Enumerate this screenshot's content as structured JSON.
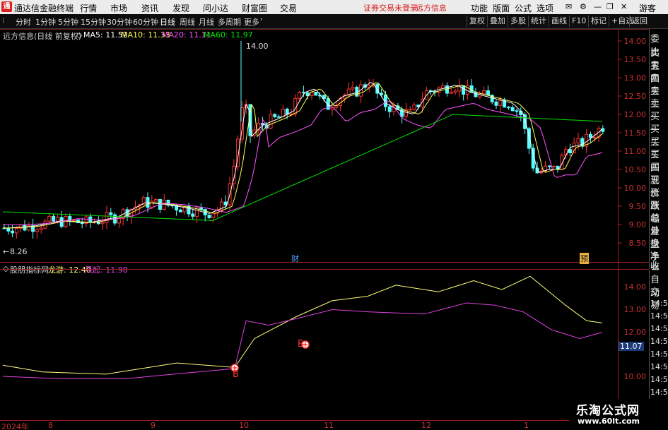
{
  "menubar": {
    "title": "通达信金融终端",
    "items": [
      "行情",
      "市场",
      "资讯",
      "发现",
      "问小达",
      "财富圈",
      "交易"
    ],
    "notice_trade": "证券交易未登录",
    "notice_info": "远方信息",
    "right_items": [
      "功能",
      "版面",
      "公式",
      "选项"
    ],
    "guest": "游客"
  },
  "toolbar": {
    "periods": [
      "分时",
      "1分钟",
      "5分钟",
      "15分钟",
      "30分钟",
      "60分钟",
      "日线",
      "周线",
      "月线",
      "多周期",
      "更多"
    ],
    "active_period": "日线",
    "buttons": [
      "复权",
      "叠加",
      "多股",
      "统计",
      "画线",
      "F10",
      "标记",
      "+自选",
      "返回"
    ]
  },
  "main_chart": {
    "stock_label": "远方信息(日线 前复权)",
    "ma5": "MA5: 11.52",
    "ma10": "MA10: 11.33",
    "ma20": "MA20: 11.11",
    "ma60": "MA60: 11.97",
    "high_mark": "14.00",
    "low_mark": "8.26",
    "marker_cai": "财",
    "marker_yu": "预",
    "y_ticks": [
      "14.00",
      "13.50",
      "13.00",
      "12.50",
      "12.00",
      "11.50",
      "11.00",
      "10.50",
      "10.00",
      "9.50",
      "9.00",
      "8.50"
    ]
  },
  "indicator": {
    "name": "股朋指标网",
    "line1": "龙游: 12.40",
    "line2": "风起: 11.98",
    "buy_label_1": "B",
    "buy_label_2": "B",
    "y_ticks": [
      "14.00",
      "13.00",
      "12.00",
      "11.00",
      "10.00"
    ],
    "current_value": "11.07"
  },
  "x_axis": [
    "2024年",
    "8",
    "9",
    "10",
    "11",
    "12",
    "1"
  ],
  "right_panel": {
    "labels": [
      "委比",
      "卖五",
      "卖四",
      "卖三",
      "卖二",
      "卖一",
      "买一",
      "买二",
      "买三",
      "买四",
      "买五",
      "现价",
      "涨跌",
      "涨幅",
      "总量",
      "外盘",
      "换手",
      "净资",
      "收益"
    ],
    "bottom_labels": [
      "自动",
      "交易"
    ],
    "times": [
      "14:56",
      "14:56",
      "14:56",
      "14:56",
      "14:56",
      "14:56",
      "14:56",
      "14:56"
    ]
  },
  "watermark": {
    "text": "乐淘公式网",
    "url": "www.60lt.com"
  },
  "colors": {
    "up": "#ff3232",
    "down": "#54ffff",
    "ma5": "#ffffff",
    "ma10": "#ffff54",
    "ma20": "#ff54ff",
    "ma60": "#00e600",
    "indicator_line1": "#ffff7a",
    "indicator_line2": "#e040e0",
    "axis": "#c83232"
  }
}
